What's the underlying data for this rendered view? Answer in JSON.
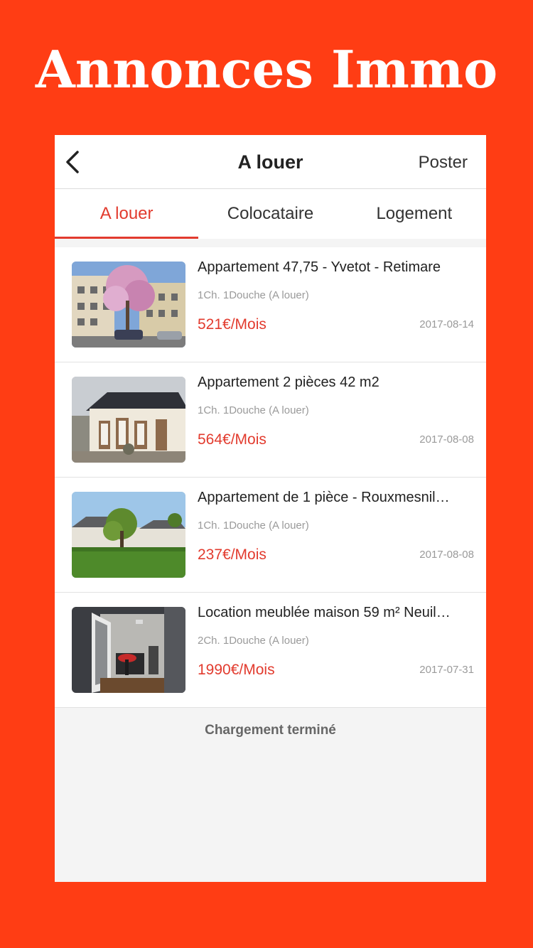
{
  "promo": {
    "title": "Annonces Immo"
  },
  "navbar": {
    "title": "A louer",
    "post_label": "Poster"
  },
  "tabs": [
    {
      "label": "A louer",
      "active": true
    },
    {
      "label": "Colocataire",
      "active": false
    },
    {
      "label": "Logement",
      "active": false
    }
  ],
  "listings": [
    {
      "title": "Appartement 47,75 - Yvetot - Retimare",
      "sub": "1Ch. 1Douche (A louer)",
      "price": "521€/Mois",
      "date": "2017-08-14",
      "photo": "apartment-building-photo"
    },
    {
      "title": "Appartement 2 pièces 42 m2",
      "sub": "1Ch. 1Douche (A louer)",
      "price": "564€/Mois",
      "date": "2017-08-08",
      "photo": "house-facade-photo"
    },
    {
      "title": "Appartement de 1 pièce - Rouxmesnil…",
      "sub": "1Ch. 1Douche (A louer)",
      "price": "237€/Mois",
      "date": "2017-08-08",
      "photo": "house-garden-photo"
    },
    {
      "title": "Location meublée maison 59 m² Neuil…",
      "sub": "2Ch. 1Douche (A louer)",
      "price": "1990€/Mois",
      "date": "2017-07-31",
      "photo": "interior-room-photo"
    }
  ],
  "footer": {
    "status": "Chargement terminé"
  },
  "colors": {
    "background": "#ff3d14",
    "accent": "#e23b2e"
  }
}
